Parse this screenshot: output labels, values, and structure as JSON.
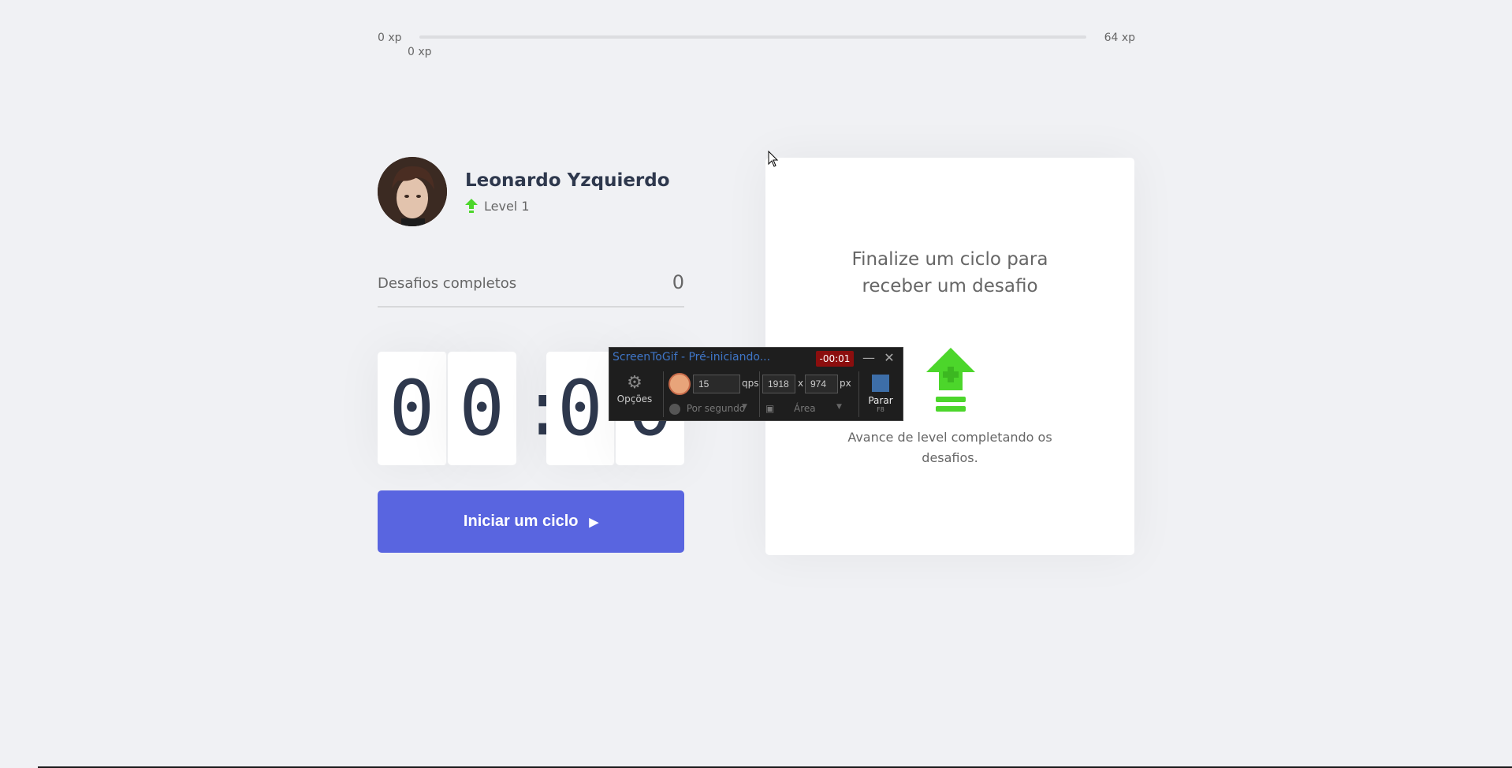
{
  "xp": {
    "min_label": "0 xp",
    "max_label": "64 xp",
    "current_label": "0 xp",
    "progress_percent": 0
  },
  "profile": {
    "name": "Leonardo Yzquierdo",
    "level": "Level 1",
    "avatar_icon": "user-avatar-photo",
    "level_icon": "level-up-arrow-icon"
  },
  "challenges": {
    "label": "Desafios completos",
    "count": "0"
  },
  "countdown": {
    "minutes": [
      "0",
      "0"
    ],
    "separator": ":",
    "seconds": [
      "0",
      "0"
    ]
  },
  "start_button": {
    "label": "Iniciar um ciclo",
    "icon": "play-icon"
  },
  "challenge_card": {
    "title_line1": "Finalize um ciclo para",
    "title_line2": "receber um desafio",
    "icon": "level-up-icon",
    "description": "Avance de level completando os desafios."
  },
  "screentogif": {
    "title": "ScreenToGif - Pré-iniciando...",
    "timer": "-00:01",
    "options_label": "Opções",
    "fps_value": "15",
    "fps_unit": "qps",
    "width_value": "1918",
    "height_value": "974",
    "times": "x",
    "size_unit": "px",
    "mode_label": "Por segundo",
    "area_label": "Área",
    "stop_label": "Parar",
    "stop_key": "F8"
  },
  "colors": {
    "background": "#f0f1f4",
    "accent_blue": "#5965e0",
    "accent_green": "#4cd62b",
    "title_text": "#2e384d",
    "body_text": "#666666"
  }
}
